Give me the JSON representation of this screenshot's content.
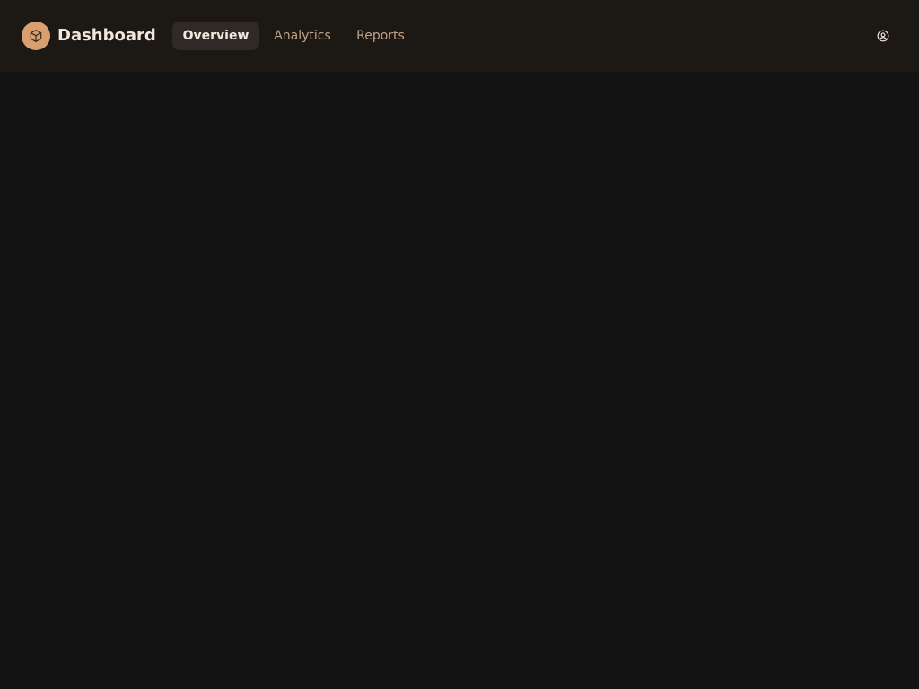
{
  "header": {
    "logo_icon": "box-icon",
    "title": "Dashboard",
    "tabs": [
      {
        "label": "Overview",
        "active": true
      },
      {
        "label": "Analytics",
        "active": false
      },
      {
        "label": "Reports",
        "active": false
      }
    ],
    "account_icon": "user-circle-icon"
  },
  "colors": {
    "header_bg": "#1c1814",
    "page_bg": "#131313",
    "accent": "#d9a06f",
    "active_tab_bg": "#2f2a26",
    "inactive_tab_text": "#c2a486",
    "active_text": "#f1e7dc"
  }
}
